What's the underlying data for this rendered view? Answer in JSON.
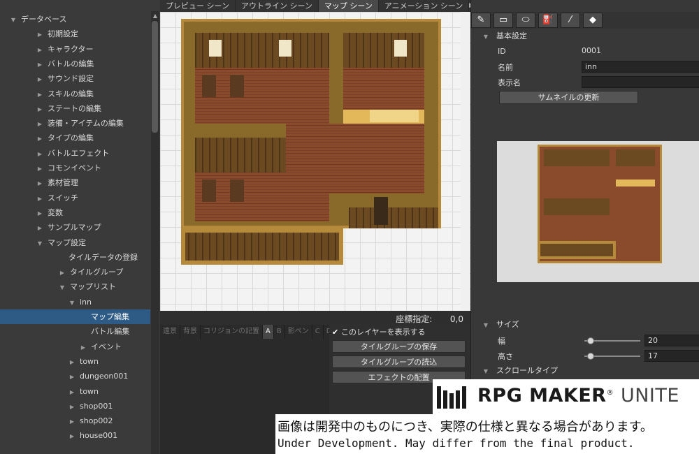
{
  "tree": {
    "items": [
      {
        "label": "データベース",
        "expanded": true,
        "selected": false
      },
      {
        "label": "初期設定",
        "expanded": false,
        "selected": false
      },
      {
        "label": "キャラクター",
        "expanded": false,
        "selected": false
      },
      {
        "label": "バトルの編集",
        "expanded": false,
        "selected": false
      },
      {
        "label": "サウンド設定",
        "expanded": false,
        "selected": false
      },
      {
        "label": "スキルの編集",
        "expanded": false,
        "selected": false
      },
      {
        "label": "ステートの編集",
        "expanded": false,
        "selected": false
      },
      {
        "label": "装備・アイテムの編集",
        "expanded": false,
        "selected": false
      },
      {
        "label": "タイプの編集",
        "expanded": false,
        "selected": false
      },
      {
        "label": "バトルエフェクト",
        "expanded": false,
        "selected": false
      },
      {
        "label": "コモンイベント",
        "expanded": false,
        "selected": false
      },
      {
        "label": "素材管理",
        "expanded": false,
        "selected": false
      },
      {
        "label": "スイッチ",
        "expanded": false,
        "selected": false
      },
      {
        "label": "変数",
        "expanded": false,
        "selected": false
      },
      {
        "label": "サンプルマップ",
        "expanded": false,
        "selected": false
      },
      {
        "label": "マップ設定",
        "expanded": true,
        "selected": false
      },
      {
        "label": "タイルデータの登録",
        "expanded": null,
        "selected": false
      },
      {
        "label": "タイルグループ",
        "expanded": false,
        "selected": false
      },
      {
        "label": "マップリスト",
        "expanded": true,
        "selected": false
      },
      {
        "label": "inn",
        "expanded": true,
        "selected": false
      },
      {
        "label": "マップ編集",
        "expanded": null,
        "selected": true
      },
      {
        "label": "バトル編集",
        "expanded": null,
        "selected": false
      },
      {
        "label": "イベント",
        "expanded": false,
        "selected": false
      },
      {
        "label": "town",
        "expanded": false,
        "selected": false
      },
      {
        "label": "dungeon001",
        "expanded": false,
        "selected": false
      },
      {
        "label": "town",
        "expanded": false,
        "selected": false
      },
      {
        "label": "shop001",
        "expanded": false,
        "selected": false
      },
      {
        "label": "shop002",
        "expanded": false,
        "selected": false
      },
      {
        "label": "house001",
        "expanded": false,
        "selected": false
      }
    ]
  },
  "tabs": [
    {
      "label": "プレビュー シーン",
      "active": false
    },
    {
      "label": "アウトライン シーン",
      "active": false
    },
    {
      "label": "マップ シーン",
      "active": true
    },
    {
      "label": "アニメーション シーン",
      "active": false
    }
  ],
  "coord": {
    "label": "座標指定:",
    "value": "0,0"
  },
  "layers": {
    "tabs": [
      {
        "label": "遠景",
        "active": false
      },
      {
        "label": "背景",
        "active": false
      },
      {
        "label": "コリジョンの記置",
        "active": false
      },
      {
        "label": "A",
        "active": true
      },
      {
        "label": "B",
        "active": false
      },
      {
        "label": "影ペン",
        "active": false
      },
      {
        "label": "C",
        "active": false
      },
      {
        "label": "D",
        "active": false
      }
    ],
    "show_layer_label": "このレイヤーを表示する",
    "show_layer_checked": true,
    "save_group_label": "タイルグループの保存",
    "load_group_label": "タイルグループの読込",
    "effect_label": "エフェクトの配置"
  },
  "inspector": {
    "basic_section": "基本設定",
    "id_label": "ID",
    "id_value": "0001",
    "name_label": "名前",
    "name_value": "inn",
    "display_name_label": "表示名",
    "display_name_value": "",
    "thumbnail_button": "サムネイルの更新",
    "size_section": "サイズ",
    "width_label": "幅",
    "width_value": "20",
    "height_label": "高さ",
    "height_value": "17",
    "scroll_section": "スクロールタイプ"
  },
  "watermark": {
    "brand_bold": "RPG MAKER",
    "brand_light": "UNITE",
    "registered": "®",
    "jp_text": "画像は開発中のものにつき、実際の仕様と異なる場合があります。",
    "en_text": "Under Development. May differ from the final product."
  }
}
